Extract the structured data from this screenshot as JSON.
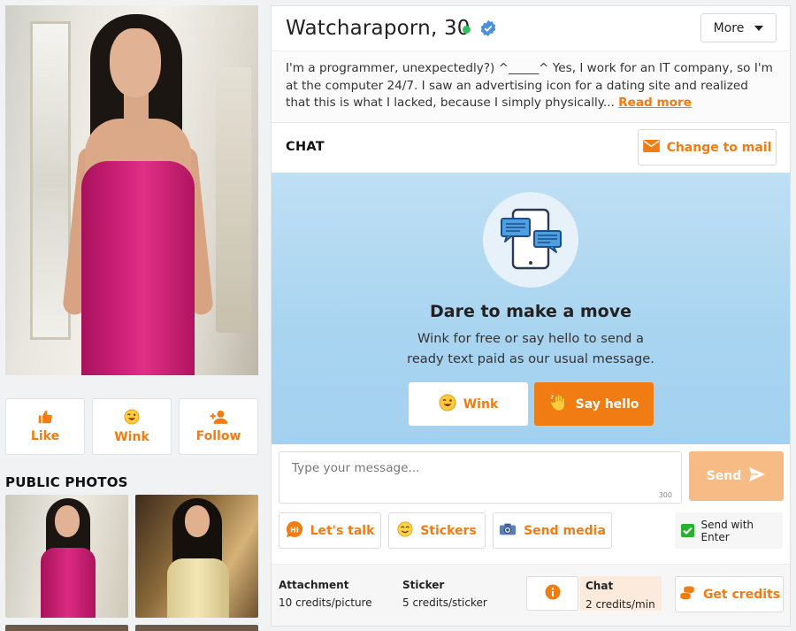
{
  "profile": {
    "name": "Watcharaporn, 30",
    "bio": "I'm a programmer, unexpectedly?) ^_____^ Yes, I work for an IT company, so I'm at the computer 24/7. I saw an advertising icon for a dating site and realized that this is what I lacked, because I simply physically...",
    "read_more": "Read more",
    "more_label": "More"
  },
  "actions": {
    "like": "Like",
    "wink": "Wink",
    "follow": "Follow"
  },
  "public_photos": {
    "title": "PUBLIC PHOTOS"
  },
  "chat": {
    "title": "CHAT",
    "change_to_mail": "Change to mail"
  },
  "promo": {
    "title": "Dare to make a move",
    "text": "Wink for free or say hello to send a ready text paid as our usual message.",
    "wink": "Wink",
    "say_hello": "Say hello"
  },
  "composer": {
    "placeholder": "Type your message...",
    "char_limit": "300",
    "send": "Send",
    "lets_talk": "Let's talk",
    "stickers": "Stickers",
    "send_media": "Send media",
    "send_with_enter": "Send with Enter"
  },
  "pricing": {
    "attachment_label": "Attachment",
    "attachment_value": "10 credits/picture",
    "sticker_label": "Sticker",
    "sticker_value": "5 credits/sticker",
    "chat_label": "Chat",
    "chat_value": "2 credits/min",
    "get_credits": "Get credits"
  },
  "colors": {
    "accent": "#f07c13",
    "online": "#2ec25a",
    "verified": "#4a90d9",
    "promo_bg": "#a8d4f0",
    "check": "#27b12f"
  },
  "icons": {
    "like": "thumbs-up-icon",
    "wink": "wink-emoji-icon",
    "follow": "add-person-icon",
    "verified": "verified-badge-icon",
    "mail": "envelope-icon",
    "send": "paper-plane-icon",
    "lets_talk": "hi-speech-bubble-icon",
    "stickers": "sticker-emoji-icon",
    "media": "camera-icon",
    "info": "info-icon",
    "credits": "coins-icon",
    "hello": "waving-hand-icon"
  }
}
